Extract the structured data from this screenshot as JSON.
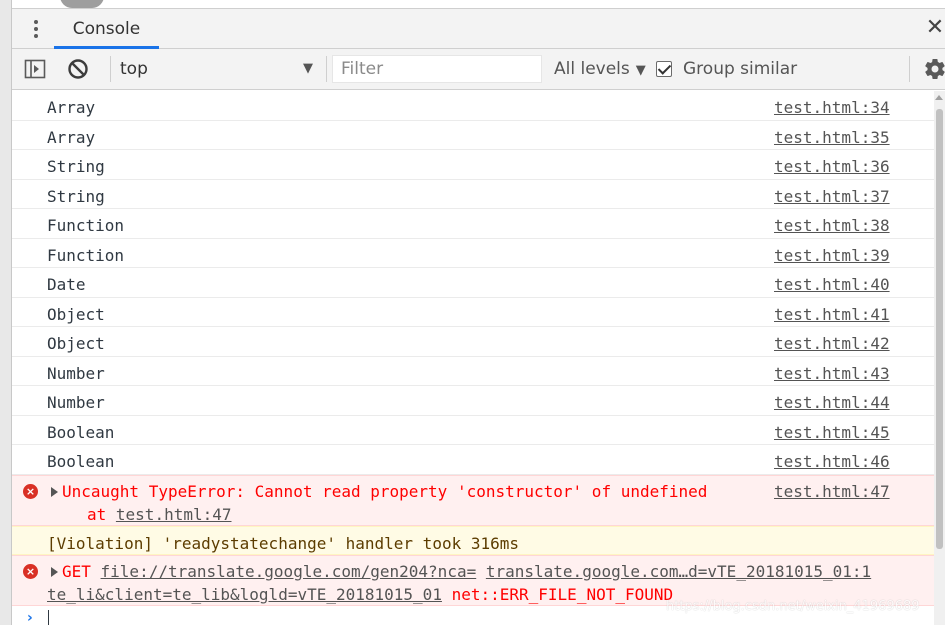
{
  "tabbar": {
    "tab_label": "Console",
    "close_glyph": "✕"
  },
  "toolbar": {
    "context_value": "top",
    "filter_placeholder": "Filter",
    "levels_label": "All levels",
    "group_similar_label": "Group similar",
    "group_similar_checked": true
  },
  "messages": [
    {
      "text": "Array",
      "source": "test.html:34"
    },
    {
      "text": "Array",
      "source": "test.html:35"
    },
    {
      "text": "String",
      "source": "test.html:36"
    },
    {
      "text": "String",
      "source": "test.html:37"
    },
    {
      "text": "Function",
      "source": "test.html:38"
    },
    {
      "text": "Function",
      "source": "test.html:39"
    },
    {
      "text": "Date",
      "source": "test.html:40"
    },
    {
      "text": "Object",
      "source": "test.html:41"
    },
    {
      "text": "Object",
      "source": "test.html:42"
    },
    {
      "text": "Number",
      "source": "test.html:43"
    },
    {
      "text": "Number",
      "source": "test.html:44"
    },
    {
      "text": "Boolean",
      "source": "test.html:45"
    },
    {
      "text": "Boolean",
      "source": "test.html:46"
    }
  ],
  "error1": {
    "icon": "×",
    "message": "Uncaught TypeError: Cannot read property 'constructor' of undefined",
    "at_prefix": "at ",
    "at_link": "test.html:47",
    "source": "test.html:47"
  },
  "warning": {
    "message": "[Violation] 'readystatechange' handler took 316ms"
  },
  "error2": {
    "icon": "×",
    "method": "GET ",
    "url": "file://translate.google.com/gen204?nca=",
    "space": " ",
    "initiator": "translate.google.com…d=vTE_20181015_01:1",
    "line2_link": "te_li&client=te_lib&logld=vTE_20181015_01",
    "line2_error": " net::ERR_FILE_NOT_FOUND"
  },
  "watermark": "https://blog.csdn.net/weixin_41969689",
  "colors": {
    "error_text": "#ff0000",
    "error_bg": "#fff0f0",
    "warning_bg": "#fffbe5",
    "tab_underline": "#1a73e8",
    "toolbar_bg": "#f3f3f3"
  },
  "icons": {
    "menu": "kebab-menu-icon",
    "sidebar": "sidebar-toggle-icon",
    "clear": "clear-console-icon",
    "settings": "gear-icon",
    "error": "error-circle-icon",
    "expand": "expand-triangle-icon",
    "prompt": "prompt-chevron-icon"
  }
}
